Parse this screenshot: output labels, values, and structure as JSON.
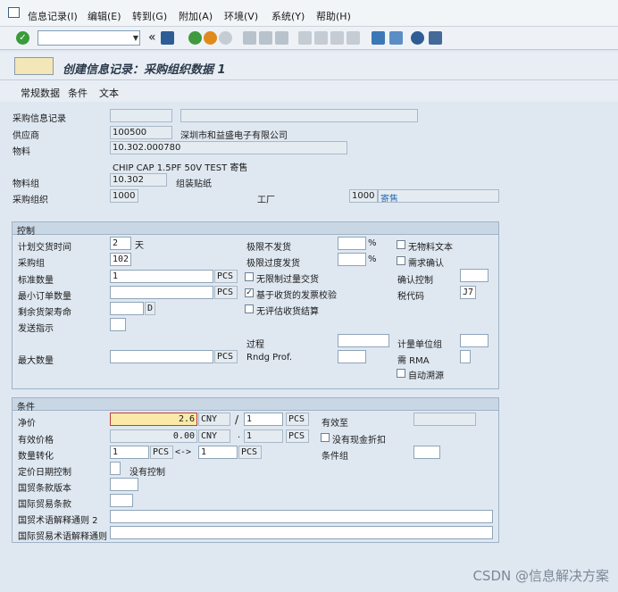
{
  "menu": [
    "信息记录(I)",
    "编辑(E)",
    "转到(G)",
    "附加(A)",
    "环境(V)",
    "系统(Y)",
    "帮助(H)"
  ],
  "toolbar": {
    "command_value": "",
    "back_label": "«"
  },
  "title": "创建信息记录：采购组织数据 1",
  "subtabs": [
    "常规数据",
    "条件",
    "文本"
  ],
  "header": {
    "info_record_label": "采购信息记录",
    "info_record_value": "",
    "info_record_desc": "",
    "vendor_label": "供应商",
    "vendor_value": "100500",
    "vendor_name": "深圳市和益盛电子有限公司",
    "material_label": "物料",
    "material_value": "10.302.000780",
    "material_desc": "CHIP CAP 1.5PF 50V TEST 寄售",
    "matgroup_label": "物料组",
    "matgroup_value": "10.302",
    "matgroup_desc": "组装贴纸",
    "purch_org_label": "采购组织",
    "purch_org_value": "1000",
    "plant_label": "工厂",
    "plant_value": "1000",
    "plant_desc": "寄售"
  },
  "control": {
    "title": "控制",
    "plan_delivery_label": "计划交货时间",
    "plan_delivery_value": "2",
    "plan_delivery_unit": "天",
    "purch_group_label": "采购组",
    "purch_group_value": "102",
    "std_qty_label": "标准数量",
    "std_qty_value": "1",
    "std_qty_unit": "PCS",
    "min_qty_label": "最小订单数量",
    "min_qty_value": "",
    "min_qty_unit": "PCS",
    "shelf_life_label": "剩余货架寿命",
    "shelf_life_value": "",
    "shelf_life_unit": "D",
    "ship_instr_label": "发送指示",
    "ship_instr_value": "",
    "max_qty_label": "最大数量",
    "max_qty_value": "",
    "max_qty_unit": "PCS",
    "under_tol_label": "极限不发货",
    "under_tol_unit": "%",
    "over_tol_label": "极限过度发货",
    "over_tol_unit": "%",
    "unlimited_label": "无限制过量交货",
    "unlimited_checked": "",
    "gr_iv_label": "基于收货的发票校验",
    "gr_iv_checked": "✓",
    "no_eval_label": "无评估收货结算",
    "no_eval_checked": "",
    "process_label": "过程",
    "rndg_label": "Rndg Prof.",
    "no_mat_text_label": "无物料文本",
    "no_mat_text_checked": "",
    "ack_req_label": "需求确认",
    "ack_req_checked": "",
    "conf_ctrl_label": "确认控制",
    "conf_ctrl_value": "",
    "tax_code_label": "税代码",
    "tax_code_value": "J7",
    "uom_group_label": "计量单位组",
    "uom_group_value": "",
    "rma_label": "需 RMA",
    "auto_src_label": "自动溯源",
    "auto_src_checked": ""
  },
  "conditions": {
    "title": "条件",
    "net_price_label": "净价",
    "net_price_value": "2.6",
    "net_price_curr": "CNY",
    "net_price_per": "1",
    "net_price_uom": "PCS",
    "valid_to_label": "有效至",
    "valid_to_value": "",
    "eff_price_label": "有效价格",
    "eff_price_value": "0.00",
    "eff_price_curr": "CNY",
    "eff_price_per": "1",
    "eff_price_uom": "PCS",
    "no_cash_disc_label": "没有现金折扣",
    "no_cash_disc_checked": "",
    "qty_conv_label": "数量转化",
    "qty_conv_left": "1",
    "qty_conv_left_uom": "PCS",
    "qty_conv_arrow": "<->",
    "qty_conv_right": "1",
    "qty_conv_right_uom": "PCS",
    "cond_group_label": "条件组",
    "cond_group_value": "",
    "pricing_date_label": "定价日期控制",
    "pricing_date_desc": "没有控制",
    "incoterms_ver_label": "国贸条款版本",
    "incoterms_label": "国际贸易条款",
    "incoterms_loc1_label": "国贸术语解释通则 2",
    "incoterms_loc2_label": "国际贸易术语解释通则"
  },
  "watermark": "CSDN @信息解决方案"
}
